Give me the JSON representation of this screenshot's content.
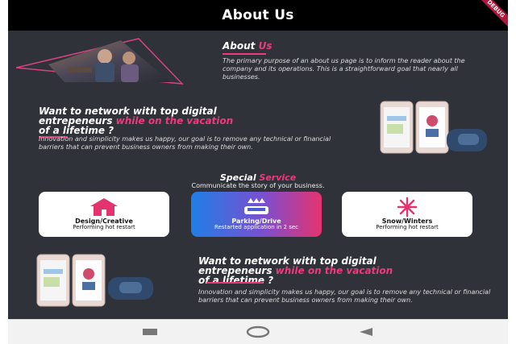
{
  "appbar": {
    "title": "About Us",
    "debug_banner": "DEBUG"
  },
  "about": {
    "title_plain": "About ",
    "title_accent": "Us",
    "text": "The primary purpose of an about us page is to inform the reader about the company and its operations. This is a straightforward goal that nearly all businesses."
  },
  "network1": {
    "line1": "Want to network with top digital",
    "line2_plain": "entrepeneurs ",
    "line2_accent": "while on the vacation",
    "line3": "of a lifetime ?",
    "text": "Innovation and simplicity makes us happy, our goal is to remove any technical or financial barriers that can prevent business owners from making their own."
  },
  "services": {
    "title_plain": "Special ",
    "title_accent": "Service",
    "subtitle": "Communicate the story of your business.",
    "cards": [
      {
        "label": "Design/Creative",
        "sub": "Performing hot restart",
        "icon": "home-icon"
      },
      {
        "label": "Parking/Drive",
        "sub": "Restarted application in 2 sec",
        "icon": "parking-car-icon"
      },
      {
        "label": "Snow/Winters",
        "sub": "Performing hot restart",
        "icon": "snowflake-icon"
      }
    ]
  },
  "network2": {
    "line1": "Want to network with top digital",
    "line2_plain": "entrepeneurs ",
    "line2_accent": "while on the vacation",
    "line3": "of a lifetime ?",
    "text": "Innovation and simplicity makes us happy, our goal is to remove any technical or financial barriers that can prevent business owners from making their own."
  },
  "navbar": {
    "icons": [
      "recents-icon",
      "home-circle-icon",
      "back-icon"
    ]
  },
  "colors": {
    "accent": "#ec3a7b",
    "background": "#30323a",
    "appbar": "#000000",
    "navbar": "#f2f2f2"
  }
}
